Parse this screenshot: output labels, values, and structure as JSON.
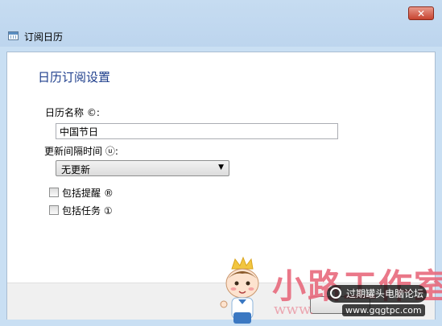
{
  "window": {
    "title": "订阅日历",
    "close_label": "✕"
  },
  "dialog": {
    "heading": "日历订阅设置",
    "name_label": "日历名称 ©:",
    "name_value": "中国节日",
    "interval_label": "更新间隔时间 ⓤ:",
    "interval_value": "无更新",
    "include_reminders_label": "包括提醒 ®",
    "include_reminders_checked": false,
    "include_tasks_label": "包括任务 ①",
    "include_tasks_checked": false
  },
  "watermark": {
    "brand": "小路工作室",
    "url": "www.",
    "badge": "过期罐头电脑论坛",
    "site": "www.gqgtpc.com"
  },
  "colors": {
    "titlebar": "#c6dcf1",
    "heading": "#1e3e8c",
    "close_button": "#c7432f",
    "watermark_pink": "#e86a7d"
  }
}
